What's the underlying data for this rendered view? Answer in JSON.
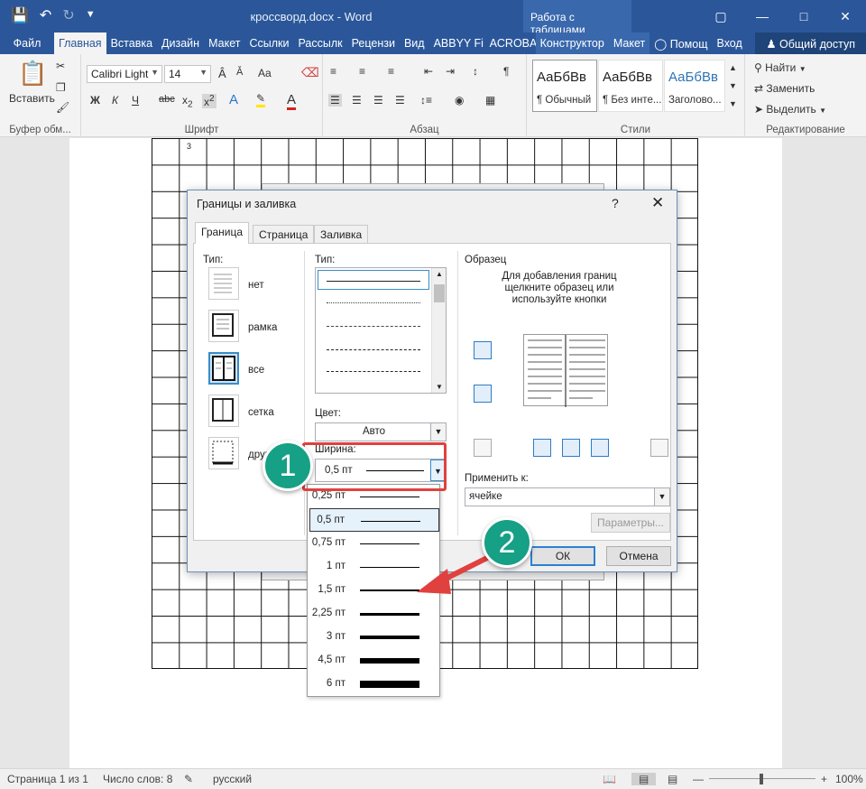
{
  "window": {
    "doc_title": "кроссворд.docx - Word",
    "context_tools": "Работа с таблицами"
  },
  "tabs": [
    "Файл",
    "Главная",
    "Вставка",
    "Дизайн",
    "Макет",
    "Ссылки",
    "Рассылк",
    "Рецензи",
    "Вид",
    "ABBYY Fi",
    "ACROBA",
    "Конструктор",
    "Макет"
  ],
  "tabs_extra": {
    "help": "Помощ",
    "login": "Вход",
    "share": "Общий доступ"
  },
  "ribbon": {
    "paste": "Вставить",
    "font_name": "Calibri Light",
    "font_size": "14",
    "groups": {
      "clipboard": "Буфер обм...",
      "font": "Шрифт",
      "paragraph": "Абзац",
      "styles": "Стили",
      "editing": "Редактирование"
    },
    "styles": [
      {
        "sample": "АаБбВв",
        "name": "¶ Обычный"
      },
      {
        "sample": "АаБбВв",
        "name": "¶ Без инте..."
      },
      {
        "sample": "АаБбВв",
        "name": "Заголово..."
      }
    ],
    "editing": {
      "find": "Найти",
      "replace": "Заменить",
      "select": "Выделить"
    }
  },
  "document": {
    "cell_number": "3"
  },
  "dialog": {
    "title": "Границы и заливка",
    "help": "?",
    "tabs": [
      "Граница",
      "Страница",
      "Заливка"
    ],
    "type_label": "Тип:",
    "settings": [
      "нет",
      "рамка",
      "все",
      "сетка",
      "другая"
    ],
    "style_label": "Тип:",
    "color_label": "Цвет:",
    "color_value": "Авто",
    "width_label": "Ширина:",
    "width_value": "0,5 пт",
    "preview_label": "Образец",
    "preview_hint": "Для добавления границ щелкните образец или используйте кнопки",
    "apply_label": "Применить к:",
    "apply_value": "ячейке",
    "params_button": "Параметры...",
    "ok_button": "ОК",
    "cancel_button": "Отмена"
  },
  "width_options": [
    {
      "label": "0,25 пт",
      "pt": 0.25
    },
    {
      "label": "0,5 пт",
      "pt": 0.5
    },
    {
      "label": "0,75 пт",
      "pt": 0.75
    },
    {
      "label": "1 пт",
      "pt": 1
    },
    {
      "label": "1,5 пт",
      "pt": 1.5
    },
    {
      "label": "2,25 пт",
      "pt": 2.25
    },
    {
      "label": "3 пт",
      "pt": 3
    },
    {
      "label": "4,5 пт",
      "pt": 4.5
    },
    {
      "label": "6 пт",
      "pt": 6
    }
  ],
  "annotations": {
    "step1": "1",
    "step2": "2"
  },
  "statusbar": {
    "page": "Страница 1 из 1",
    "words": "Число слов: 8",
    "lang": "русский",
    "zoom": "100%"
  },
  "colors": {
    "word_blue": "#2b579a",
    "annotation_green": "#16a085",
    "annotation_red": "#e0413e"
  }
}
